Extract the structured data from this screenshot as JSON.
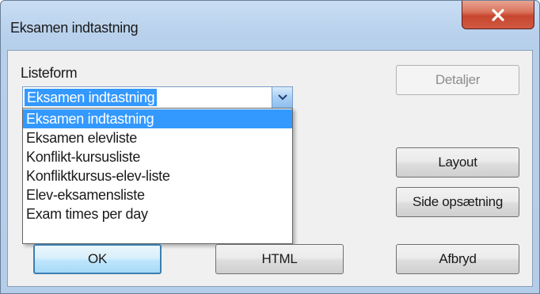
{
  "window": {
    "title": "Eksamen indtastning"
  },
  "listeform": {
    "label": "Listeform",
    "selected_value": "Eksamen indtastning",
    "options": [
      "Eksamen indtastning",
      "Eksamen elevliste",
      "Konflikt-kursusliste",
      "Konfliktkursus-elev-liste",
      "Elev-eksamensliste",
      "Exam times per day"
    ]
  },
  "buttons": {
    "details": "Detaljer",
    "layout": "Layout",
    "page_setup": "Side opsætning",
    "ok": "OK",
    "html": "HTML",
    "cancel": "Afbryd"
  },
  "icons": {
    "close": "close-icon",
    "dropdown_arrow": "chevron-down-icon"
  },
  "colors": {
    "selection": "#3399ff",
    "close_button": "#c8452e",
    "title_bar": "#b9d1ec"
  }
}
